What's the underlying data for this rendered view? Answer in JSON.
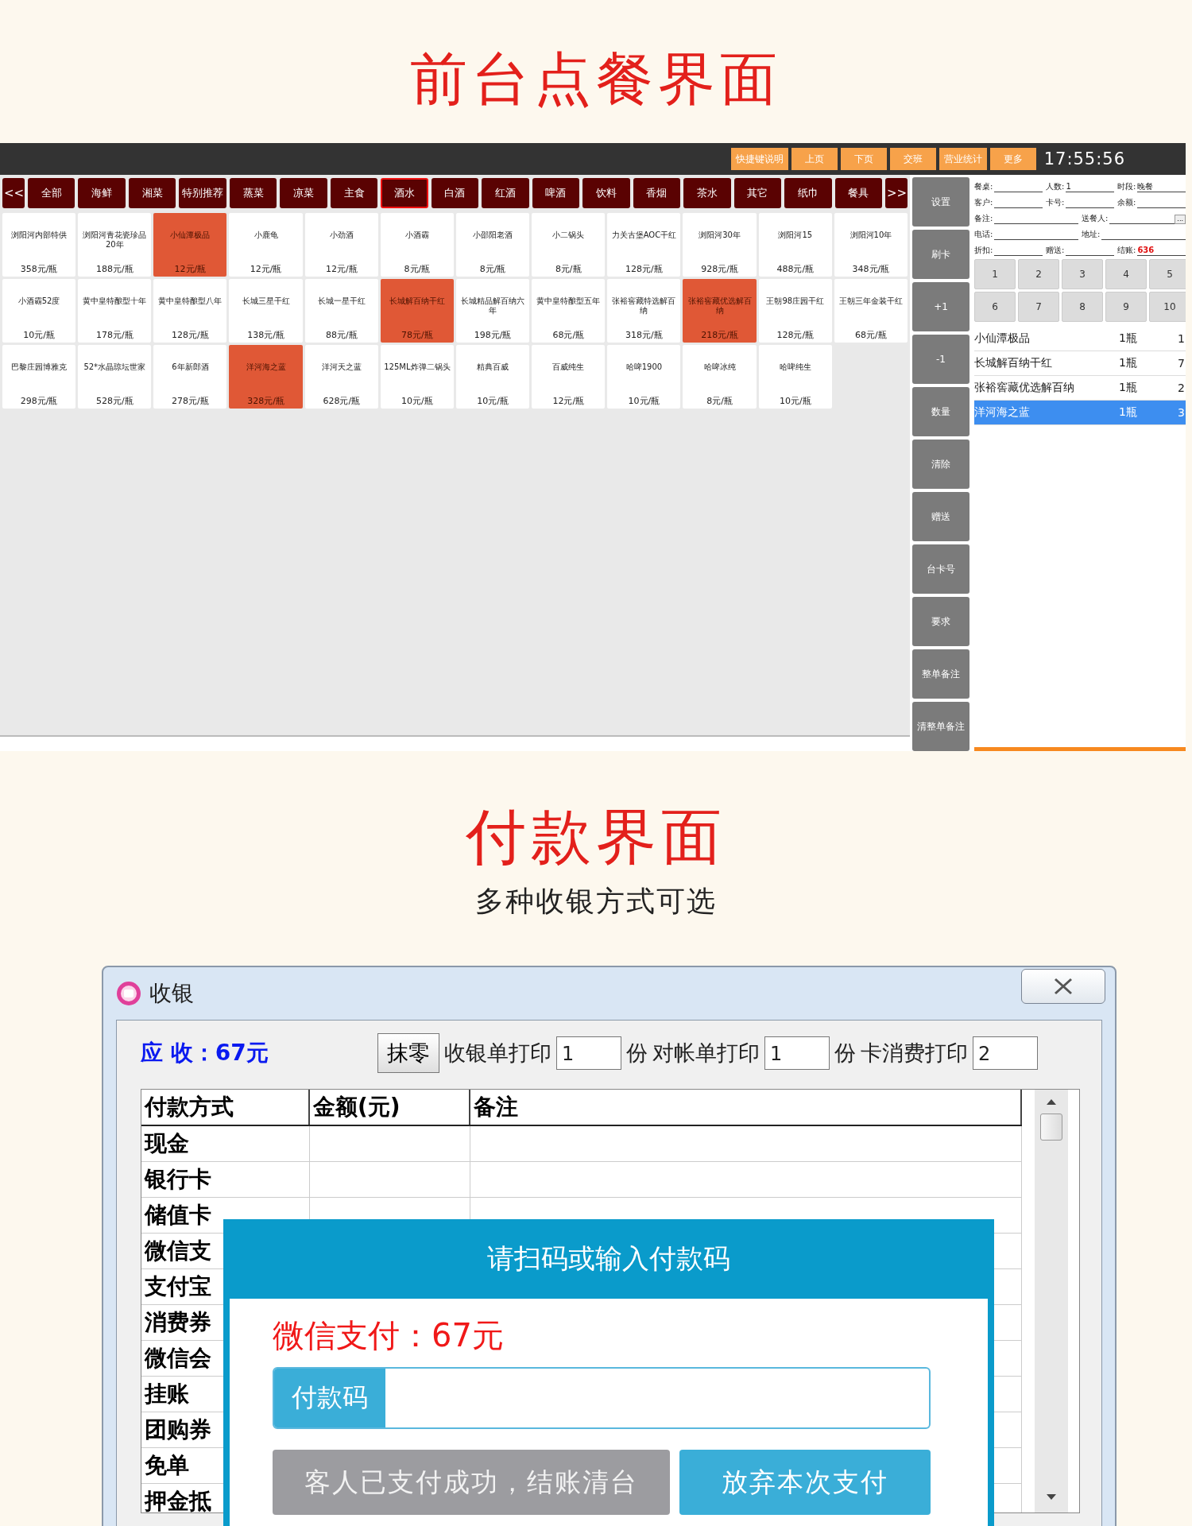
{
  "section_title": "前台点餐界面",
  "pos": {
    "toolbar": {
      "buttons": [
        "快捷键说明",
        "上页",
        "下页",
        "交班",
        "营业统计",
        "更多"
      ],
      "time": "17:55:56"
    },
    "category_prev": "<<",
    "category_next": ">>",
    "categories": [
      {
        "label": "全部",
        "selected": false
      },
      {
        "label": "海鲜",
        "selected": false
      },
      {
        "label": "湘菜",
        "selected": false
      },
      {
        "label": "特别推荐",
        "selected": false
      },
      {
        "label": "蒸菜",
        "selected": false
      },
      {
        "label": "凉菜",
        "selected": false
      },
      {
        "label": "主食",
        "selected": false
      },
      {
        "label": "酒水",
        "selected": true
      },
      {
        "label": "白酒",
        "selected": false
      },
      {
        "label": "红酒",
        "selected": false
      },
      {
        "label": "啤酒",
        "selected": false
      },
      {
        "label": "饮料",
        "selected": false
      },
      {
        "label": "香烟",
        "selected": false
      },
      {
        "label": "茶水",
        "selected": false
      },
      {
        "label": "其它",
        "selected": false
      },
      {
        "label": "纸巾",
        "selected": false
      },
      {
        "label": "餐具",
        "selected": false
      }
    ],
    "products": [
      {
        "name": "浏阳河内部特供",
        "price": "358元/瓶",
        "selected": false
      },
      {
        "name": "浏阳河青花瓷珍品20年",
        "price": "188元/瓶",
        "selected": false
      },
      {
        "name": "小仙潭极品",
        "price": "12元/瓶",
        "selected": true
      },
      {
        "name": "小鹿龟",
        "price": "12元/瓶",
        "selected": false
      },
      {
        "name": "小劲酒",
        "price": "12元/瓶",
        "selected": false
      },
      {
        "name": "小酒霸",
        "price": "8元/瓶",
        "selected": false
      },
      {
        "name": "小邵阳老酒",
        "price": "8元/瓶",
        "selected": false
      },
      {
        "name": "小二锅头",
        "price": "8元/瓶",
        "selected": false
      },
      {
        "name": "力关古堡AOC干红",
        "price": "128元/瓶",
        "selected": false
      },
      {
        "name": "浏阳河30年",
        "price": "928元/瓶",
        "selected": false
      },
      {
        "name": "浏阳河15",
        "price": "488元/瓶",
        "selected": false
      },
      {
        "name": "浏阳河10年",
        "price": "348元/瓶",
        "selected": false
      },
      {
        "name": "小酒霸52度",
        "price": "10元/瓶",
        "selected": false
      },
      {
        "name": "黄中皇特酿型十年",
        "price": "178元/瓶",
        "selected": false
      },
      {
        "name": "黄中皇特酿型八年",
        "price": "128元/瓶",
        "selected": false
      },
      {
        "name": "长城三星干红",
        "price": "138元/瓶",
        "selected": false
      },
      {
        "name": "长城一星干红",
        "price": "88元/瓶",
        "selected": false
      },
      {
        "name": "长城解百纳干红",
        "price": "78元/瓶",
        "selected": true
      },
      {
        "name": "长城精品解百纳六年",
        "price": "198元/瓶",
        "selected": false
      },
      {
        "name": "黄中皇特酿型五年",
        "price": "68元/瓶",
        "selected": false
      },
      {
        "name": "张裕窖藏特选解百纳",
        "price": "318元/瓶",
        "selected": false
      },
      {
        "name": "张裕窖藏优选解百纳",
        "price": "218元/瓶",
        "selected": true
      },
      {
        "name": "王朝98庄园干红",
        "price": "128元/瓶",
        "selected": false
      },
      {
        "name": "王朝三年金装干红",
        "price": "68元/瓶",
        "selected": false
      },
      {
        "name": "巴黎庄园博雅克",
        "price": "298元/瓶",
        "selected": false
      },
      {
        "name": "52*水晶琼坛世家",
        "price": "528元/瓶",
        "selected": false
      },
      {
        "name": "6年新郎酒",
        "price": "278元/瓶",
        "selected": false
      },
      {
        "name": "洋河海之蓝",
        "price": "328元/瓶",
        "selected": true
      },
      {
        "name": "洋河天之蓝",
        "price": "628元/瓶",
        "selected": false
      },
      {
        "name": "125ML炸弹二锅头",
        "price": "10元/瓶",
        "selected": false
      },
      {
        "name": "精典百威",
        "price": "10元/瓶",
        "selected": false
      },
      {
        "name": "百威纯生",
        "price": "12元/瓶",
        "selected": false
      },
      {
        "name": "哈啤1900",
        "price": "10元/瓶",
        "selected": false
      },
      {
        "name": "哈啤冰纯",
        "price": "8元/瓶",
        "selected": false
      },
      {
        "name": "哈啤纯生",
        "price": "10元/瓶",
        "selected": false
      }
    ],
    "side_buttons": [
      "设置",
      "刷卡",
      "+1",
      "-1",
      "数量",
      "清除",
      "赠送",
      "台卡号",
      "要求",
      "整单备注",
      "清整单备注"
    ],
    "order_form": [
      [
        {
          "label": "餐桌:"
        },
        {
          "label": "人数:",
          "value": "1"
        },
        {
          "label": "时段:",
          "value": "晚餐"
        }
      ],
      [
        {
          "label": "客户:"
        },
        {
          "label": "卡号:"
        },
        {
          "label": "余额:"
        }
      ],
      [
        {
          "label": "备注:"
        },
        {
          "label": "送餐人:",
          "button": "..."
        }
      ],
      [
        {
          "label": "电话:"
        },
        {
          "label": "地址:"
        }
      ],
      [
        {
          "label": "折扣:"
        },
        {
          "label": "赠送:"
        },
        {
          "label": "结账:",
          "value": "636",
          "kind": "total"
        }
      ]
    ],
    "keypad": [
      "1",
      "2",
      "3",
      "4",
      "5",
      "6",
      "7",
      "8",
      "9",
      "10"
    ],
    "order_items": [
      {
        "name": "小仙潭极品",
        "qty": "1瓶",
        "price": "1",
        "selected": false
      },
      {
        "name": "长城解百纳干红",
        "qty": "1瓶",
        "price": "7",
        "selected": false
      },
      {
        "name": "张裕窖藏优选解百纳",
        "qty": "1瓶",
        "price": "2",
        "selected": false
      },
      {
        "name": "洋河海之蓝",
        "qty": "1瓶",
        "price": "3",
        "selected": true
      }
    ]
  },
  "payment_title": "付款界面",
  "payment_subtitle": "多种收银方式可选",
  "dialog": {
    "title": "收银",
    "amount_due": "应 收：67元",
    "round_button": "抹零",
    "print_options": [
      {
        "label": "收银单打印",
        "value": "1",
        "unit": "份"
      },
      {
        "label": "对帐单打印",
        "value": "1",
        "unit": "份"
      },
      {
        "label": "卡消费打印",
        "value": "2"
      }
    ],
    "table": {
      "columns": [
        "付款方式",
        "金额(元)",
        "备注"
      ],
      "rows": [
        "现金",
        "银行卡",
        "储值卡",
        "微信支",
        "支付宝",
        "消费券",
        "微信会",
        "挂账",
        "团购券",
        "免单",
        "押金抵"
      ]
    },
    "scan_popup": {
      "title": "请扫码或输入付款码",
      "amount": "微信支付：67元",
      "field_label": "付款码",
      "buttons": [
        {
          "label": "客人已支付成功，结账清台",
          "kind": "confirm"
        },
        {
          "label": "放弃本次支付",
          "kind": "cancel"
        }
      ]
    }
  }
}
